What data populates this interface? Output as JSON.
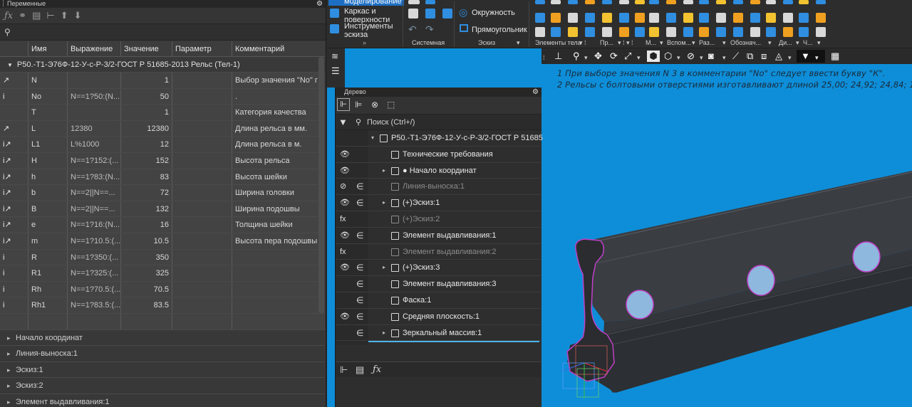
{
  "variables_panel": {
    "title": "Переменные",
    "search_icon": "search-icon",
    "columns": [
      "Имя",
      "Выражение",
      "Значение",
      "Параметр",
      "Комментарий"
    ],
    "group_title": "P50.-T1-Э76Ф-12-У-с-Р-3/2-ГОСТ Р 51685-2013 Рельс (Тел-1)",
    "rows": [
      {
        "icon": "↗",
        "name": "N",
        "expr": "",
        "value": "1",
        "param": "",
        "comment": "Выбор значения \"No\" г"
      },
      {
        "icon": "i",
        "name": "No",
        "expr": "N==1?50:(N...",
        "value": "50",
        "param": "",
        "comment": "."
      },
      {
        "icon": "",
        "name": "T",
        "expr": "",
        "value": "1",
        "param": "",
        "comment": "Категория качества"
      },
      {
        "icon": "↗",
        "name": "L",
        "expr": "12380",
        "value": "12380",
        "param": "",
        "comment": "Длина рельса в мм."
      },
      {
        "icon": "i↗",
        "name": "L1",
        "expr": "L%1000",
        "value": "12",
        "param": "",
        "comment": "Длина рельса в м."
      },
      {
        "icon": "i↗",
        "name": "H",
        "expr": "N==1?152:(...",
        "value": "152",
        "param": "",
        "comment": "Высота рельса"
      },
      {
        "icon": "i↗",
        "name": "h",
        "expr": "N==1?83:(N...",
        "value": "83",
        "param": "",
        "comment": "Высота шейки"
      },
      {
        "icon": "i↗",
        "name": "b",
        "expr": "N==2||N==...",
        "value": "72",
        "param": "",
        "comment": "Ширина головки"
      },
      {
        "icon": "i↗",
        "name": "B",
        "expr": "N==2||N==...",
        "value": "132",
        "param": "",
        "comment": "Ширина подошвы"
      },
      {
        "icon": "i↗",
        "name": "e",
        "expr": "N==1?16:(N...",
        "value": "16",
        "param": "",
        "comment": "Толщина шейки"
      },
      {
        "icon": "i↗",
        "name": "m",
        "expr": "N==1?10.5:(...",
        "value": "10.5",
        "param": "",
        "comment": "Высота пера подошвы"
      },
      {
        "icon": "i",
        "name": "R",
        "expr": "N==1?350:(...",
        "value": "350",
        "param": "",
        "comment": ""
      },
      {
        "icon": "i",
        "name": "R1",
        "expr": "N==1?325:(...",
        "value": "325",
        "param": "",
        "comment": ""
      },
      {
        "icon": "i",
        "name": "Rh",
        "expr": "N==1?70.5:(...",
        "value": "70.5",
        "param": "",
        "comment": ""
      },
      {
        "icon": "i",
        "name": "Rh1",
        "expr": "N==1?83.5:(...",
        "value": "83.5",
        "param": "",
        "comment": ""
      },
      {
        "icon": "",
        "name": "",
        "expr": "",
        "value": "",
        "param": "",
        "comment": ""
      }
    ],
    "sections": [
      "Начало координат",
      "Линия-выноска:1",
      "Эскиз:1",
      "Эскиз:2",
      "Элемент выдавливания:1"
    ]
  },
  "ribbon": {
    "tab_modeling": "моделирование",
    "btn_frame": "Каркас и поверхности",
    "btn_frame_line1": "Каркас и",
    "btn_frame_line2": "поверхности",
    "btn_sketch_tools_line1": "Инструменты",
    "btn_sketch_tools_line2": "эскиза",
    "circle": "Окружность",
    "rectangle": "Прямоугольник",
    "sections": {
      "system": "Системная",
      "sketch": "Эскиз",
      "body_elements": "Элементы тела",
      "pr": "Пр...",
      "m": "М...",
      "aux": "Вспом...",
      "raz": "Раз...",
      "designations": "Обознач...",
      "di": "Ди...",
      "ch": "Ч..."
    }
  },
  "viewport": {
    "note_1": "1  При выборе значения N 3 в комментарии \"No\" следует ввести букву \"К\".",
    "note_2": "2  Рельсы с болтовыми отверстиями изготавливают длиной 25,00; 24,92; 24,84; 12"
  },
  "tree_panel": {
    "title": "Дерево",
    "search_placeholder": "Поиск (Ctrl+/)",
    "items": [
      {
        "label": "P50.-T1-Э76Ф-12-У-с-Р-3/2-ГОСТ Р 51685",
        "eye": "",
        "inc": "",
        "arrow": "▾",
        "dim": false,
        "indent": 62
      },
      {
        "label": "Технические требования",
        "eye": "👁",
        "inc": "",
        "arrow": "",
        "dim": false,
        "indent": 78
      },
      {
        "label": "● Начало координат",
        "eye": "👁",
        "inc": "",
        "arrow": "▸",
        "dim": false,
        "indent": 78
      },
      {
        "label": "Линия-выноска:1",
        "eye": "⊘",
        "inc": "∈",
        "arrow": "",
        "dim": true,
        "indent": 78
      },
      {
        "label": "(+)Эскиз:1",
        "eye": "👁",
        "inc": "∈",
        "arrow": "▸",
        "dim": false,
        "indent": 78
      },
      {
        "label": "(+)Эскиз:2",
        "eye": "fx",
        "inc": "",
        "arrow": "",
        "dim": true,
        "indent": 78
      },
      {
        "label": "Элемент выдавливания:1",
        "eye": "👁",
        "inc": "∈",
        "arrow": "",
        "dim": false,
        "indent": 78
      },
      {
        "label": "Элемент выдавливания:2",
        "eye": "fx",
        "inc": "",
        "arrow": "",
        "dim": true,
        "indent": 78
      },
      {
        "label": "(+)Эскиз:3",
        "eye": "👁",
        "inc": "∈",
        "arrow": "▸",
        "dim": false,
        "indent": 78
      },
      {
        "label": "Элемент выдавливания:3",
        "eye": "",
        "inc": "∈",
        "arrow": "",
        "dim": false,
        "indent": 78
      },
      {
        "label": "Фаска:1",
        "eye": "",
        "inc": "∈",
        "arrow": "",
        "dim": false,
        "indent": 78
      },
      {
        "label": "Средняя плоскость:1",
        "eye": "👁",
        "inc": "∈",
        "arrow": "",
        "dim": false,
        "indent": 78
      },
      {
        "label": "Зеркальный массив:1",
        "eye": "",
        "inc": "∈",
        "arrow": "▸",
        "dim": false,
        "indent": 78
      }
    ]
  },
  "colors": {
    "viewport_bg": "#0e8ed8",
    "panel_bg": "#3a3a3a",
    "accent": "#2f8ee0",
    "rail": "#3a3d42"
  }
}
